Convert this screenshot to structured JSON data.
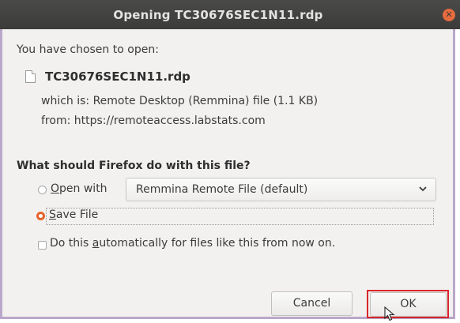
{
  "window": {
    "title": "Opening TC30676SEC1N11.rdp",
    "close_icon": "close-icon"
  },
  "intro": "You have chosen to open:",
  "file": {
    "icon": "file-icon",
    "name": "TC30676SEC1N11.rdp",
    "which_is": "which is: Remote Desktop (Remmina) file (1.1 KB)",
    "from": "from: https://remoteaccess.labstats.com"
  },
  "question": "What should Firefox do with this file?",
  "options": {
    "open_with_prefix": "O",
    "open_with_rest": "pen with",
    "open_with_selected": false,
    "app_select_value": "Remmina Remote File (default)",
    "save_file_prefix": "S",
    "save_file_rest": "ave File",
    "save_file_selected": true
  },
  "auto_checkbox": {
    "prefix": "Do this ",
    "accel": "a",
    "rest": "utomatically for files like this from now on.",
    "checked": false
  },
  "buttons": {
    "cancel": "Cancel",
    "ok": "OK"
  },
  "colors": {
    "titlebar": "#3b3b39",
    "accent_radio": "#e5632a",
    "close_button": "#e66b3e",
    "highlight_box": "#d9262b",
    "window_border": "#b9a8c9"
  }
}
